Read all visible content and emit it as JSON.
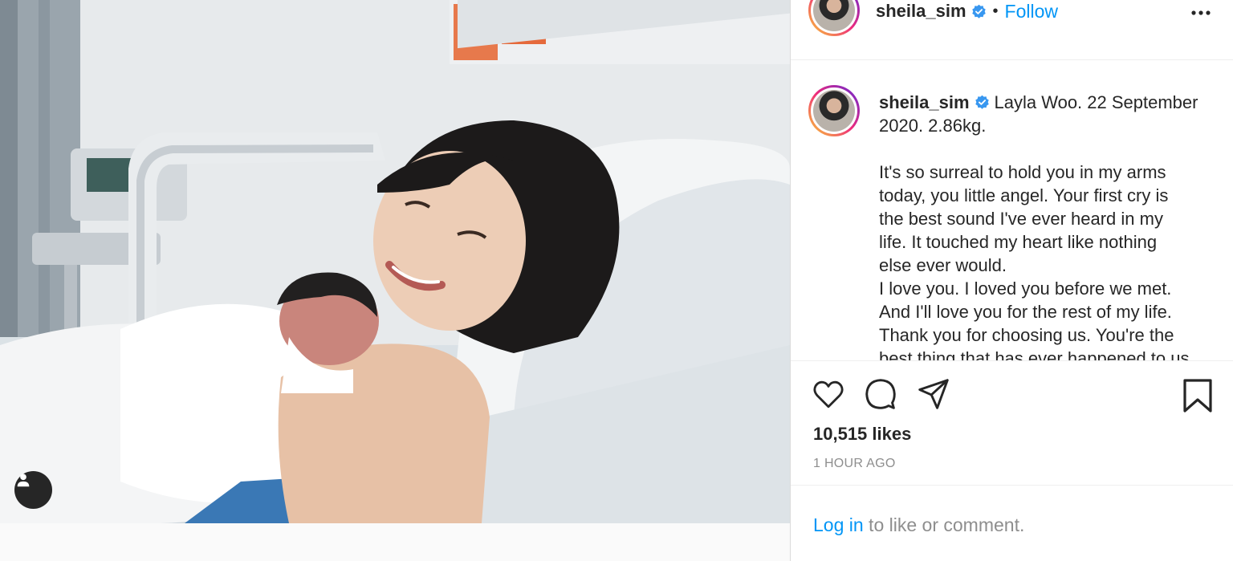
{
  "post": {
    "username": "sheila_sim",
    "follow_label": "Follow",
    "separator": "•",
    "caption": {
      "first_line": "Layla Woo. 22 September",
      "lines": [
        "2020. 2.86kg.",
        "",
        "It's so surreal to hold you in my arms",
        "today, you little angel. Your first cry is",
        "the best sound I've ever heard in my",
        "life. It touched my heart like nothing",
        "else ever would.",
        "I love you. I loved you before we met.",
        "And I'll love you for the rest of my life.",
        "Thank you for choosing us. You're the",
        "best thing that has ever happened to us."
      ]
    },
    "likes": "10,515 likes",
    "time": "1 HOUR AGO",
    "login_link": "Log in",
    "login_rest": " to like or comment."
  },
  "icons": {
    "verified": "verified-badge-icon",
    "more": "more-options-icon",
    "like": "heart-icon",
    "comment": "comment-icon",
    "share": "share-icon",
    "save": "bookmark-icon",
    "tag": "user-tag-icon"
  },
  "colors": {
    "link_blue": "#0095f6",
    "text": "#262626",
    "muted": "#8e8e8e",
    "border": "#dbdbdb"
  }
}
